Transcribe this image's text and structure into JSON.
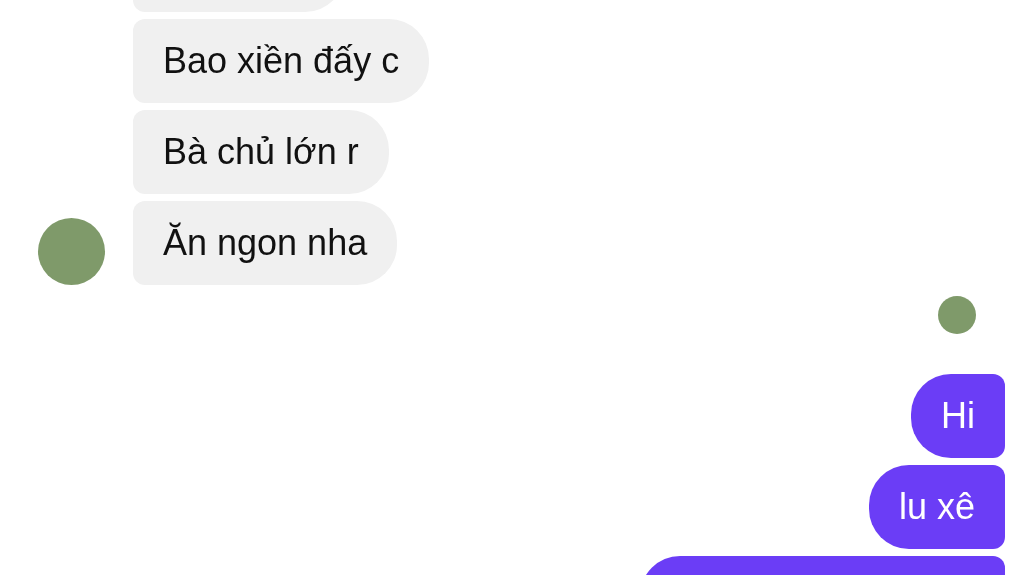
{
  "messages": [
    {
      "kind": "incoming",
      "avatar": false
    },
    {
      "kind": "incoming",
      "text": "Bao xiền đấy c",
      "avatar": false
    },
    {
      "kind": "incoming",
      "text": "Bà chủ lớn r",
      "avatar": false
    },
    {
      "kind": "incoming",
      "text": "Ăn ngon nha",
      "avatar": true
    },
    {
      "kind": "receipt"
    },
    {
      "kind": "outgoing",
      "text": "Hi"
    },
    {
      "kind": "outgoing",
      "text": "lu xê"
    },
    {
      "kind": "outgoing"
    }
  ]
}
